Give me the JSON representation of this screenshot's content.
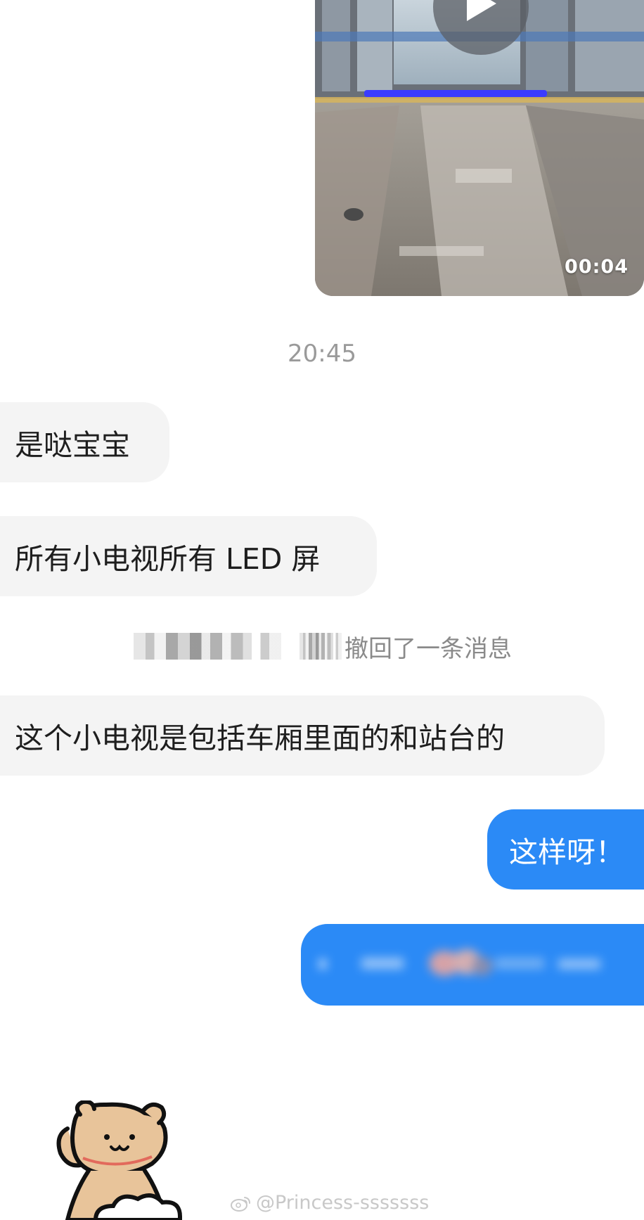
{
  "video": {
    "duration": "00:04",
    "play_icon": "play-icon"
  },
  "timestamp": "20:45",
  "messages": [
    {
      "side": "incoming",
      "text": "是哒宝宝"
    },
    {
      "side": "incoming",
      "text": "所有小电视所有 LED 屏"
    },
    {
      "side": "incoming",
      "text": "这个小电视是包括车厢里面的和站台的"
    },
    {
      "side": "outgoing",
      "text": "这样呀！"
    }
  ],
  "system_notice": {
    "text": "撤回了一条消息"
  },
  "watermark": {
    "text": "@Princess-sssssss",
    "icon": "weibo-icon"
  },
  "colors": {
    "outgoing_bubble": "#2b8af6",
    "incoming_bubble": "#f4f4f4",
    "timestamp": "#9a9a9a",
    "notice": "#8a8a8a"
  }
}
